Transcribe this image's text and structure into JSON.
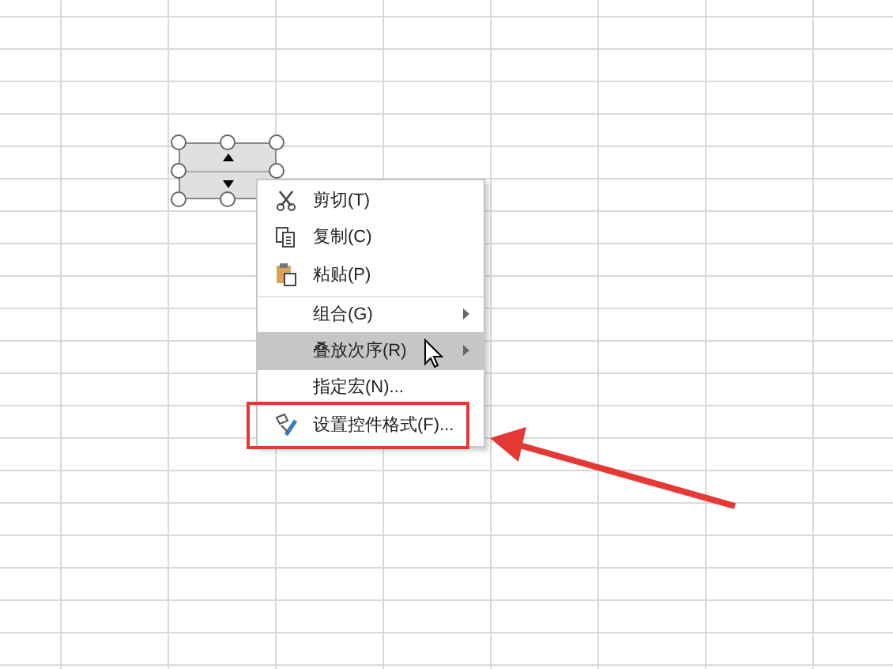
{
  "spin_button": {
    "selected": true
  },
  "context_menu": {
    "items": [
      {
        "label": "剪切(T)",
        "kind": "cut",
        "submenu": false,
        "selected": false,
        "separator_before": false,
        "highlighted_by_annotation": false
      },
      {
        "label": "复制(C)",
        "kind": "copy",
        "submenu": false,
        "selected": false,
        "separator_before": false,
        "highlighted_by_annotation": false
      },
      {
        "label": "粘贴(P)",
        "kind": "paste",
        "submenu": false,
        "selected": false,
        "separator_before": false,
        "highlighted_by_annotation": false
      },
      {
        "label": "组合(G)",
        "kind": "plain",
        "submenu": true,
        "selected": false,
        "separator_before": true,
        "highlighted_by_annotation": false
      },
      {
        "label": "叠放次序(R)",
        "kind": "plain",
        "submenu": true,
        "selected": true,
        "separator_before": false,
        "highlighted_by_annotation": false
      },
      {
        "label": "指定宏(N)...",
        "kind": "plain",
        "submenu": false,
        "selected": false,
        "separator_before": false,
        "highlighted_by_annotation": false
      },
      {
        "label": "设置控件格式(F)...",
        "kind": "format",
        "submenu": false,
        "selected": false,
        "separator_before": false,
        "highlighted_by_annotation": true
      }
    ]
  }
}
